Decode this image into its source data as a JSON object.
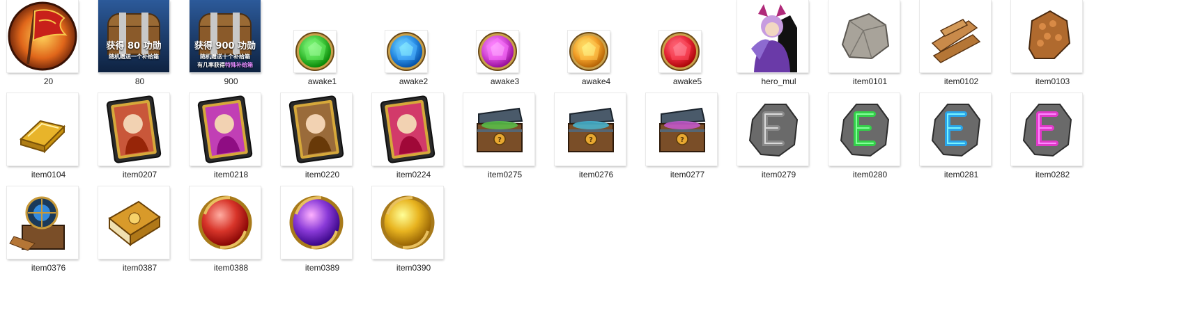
{
  "window": {
    "title": ""
  },
  "files": [
    {
      "name": "20",
      "icon": "war-flag-icon",
      "kind": "big"
    },
    {
      "name": "80",
      "icon": "treasure-chest-banner-icon",
      "kind": "big",
      "banner": [
        "获得",
        "80",
        "功勋",
        "随机赠送一个补给箱"
      ]
    },
    {
      "name": "900",
      "icon": "treasure-chest-banner-icon",
      "kind": "big",
      "banner": [
        "获得",
        "900",
        "功勋",
        "随机赠送十个补给箱",
        "有几率获得",
        "特殊补给箱"
      ]
    },
    {
      "name": "awake1",
      "icon": "green-gem-icon",
      "kind": "small",
      "color": "#3fc53a"
    },
    {
      "name": "awake2",
      "icon": "blue-gem-icon",
      "kind": "small",
      "color": "#2b8fe6"
    },
    {
      "name": "awake3",
      "icon": "magenta-gem-icon",
      "kind": "small",
      "color": "#d54ad8"
    },
    {
      "name": "awake4",
      "icon": "orange-gem-icon",
      "kind": "small",
      "color": "#f3a12a"
    },
    {
      "name": "awake5",
      "icon": "red-gem-icon",
      "kind": "small",
      "color": "#e8283a"
    },
    {
      "name": "hero_mul",
      "icon": "hero-character-icon",
      "kind": "big"
    },
    {
      "name": "item0101",
      "icon": "stone-icon",
      "kind": "big"
    },
    {
      "name": "item0102",
      "icon": "wood-planks-icon",
      "kind": "big"
    },
    {
      "name": "item0103",
      "icon": "ore-icon",
      "kind": "big"
    },
    {
      "name": "item0104",
      "icon": "gold-bar-icon",
      "kind": "big"
    },
    {
      "name": "item0207",
      "icon": "hero-card-icon",
      "kind": "big",
      "color": "#c9573a"
    },
    {
      "name": "item0218",
      "icon": "hero-card-icon",
      "kind": "big",
      "color": "#c13fb5"
    },
    {
      "name": "item0220",
      "icon": "hero-card-icon",
      "kind": "big",
      "color": "#9a6b3a"
    },
    {
      "name": "item0224",
      "icon": "hero-card-icon",
      "kind": "big",
      "color": "#d23a6a"
    },
    {
      "name": "item0275",
      "icon": "open-chest-icon",
      "kind": "big",
      "color": "#58c34a"
    },
    {
      "name": "item0276",
      "icon": "open-chest-icon",
      "kind": "big",
      "color": "#45b9d6"
    },
    {
      "name": "item0277",
      "icon": "open-chest-icon",
      "kind": "big",
      "color": "#c85ad2"
    },
    {
      "name": "item0279",
      "icon": "rune-stone-icon",
      "kind": "big",
      "color": "#8a8a8a"
    },
    {
      "name": "item0280",
      "icon": "rune-stone-icon",
      "kind": "big",
      "color": "#34d04a"
    },
    {
      "name": "item0281",
      "icon": "rune-stone-icon",
      "kind": "big",
      "color": "#2aa4e8"
    },
    {
      "name": "item0282",
      "icon": "rune-stone-icon",
      "kind": "big",
      "color": "#e03ac8"
    },
    {
      "name": "item0376",
      "icon": "crystal-chest-icon",
      "kind": "big"
    },
    {
      "name": "item0387",
      "icon": "book-icon",
      "kind": "big"
    },
    {
      "name": "item0388",
      "icon": "red-orb-icon",
      "kind": "big",
      "color": "#d8352a"
    },
    {
      "name": "item0389",
      "icon": "purple-orb-icon",
      "kind": "big",
      "color": "#8a3ad8"
    },
    {
      "name": "item0390",
      "icon": "gold-orb-icon",
      "kind": "big",
      "color": "#e8b420"
    }
  ]
}
